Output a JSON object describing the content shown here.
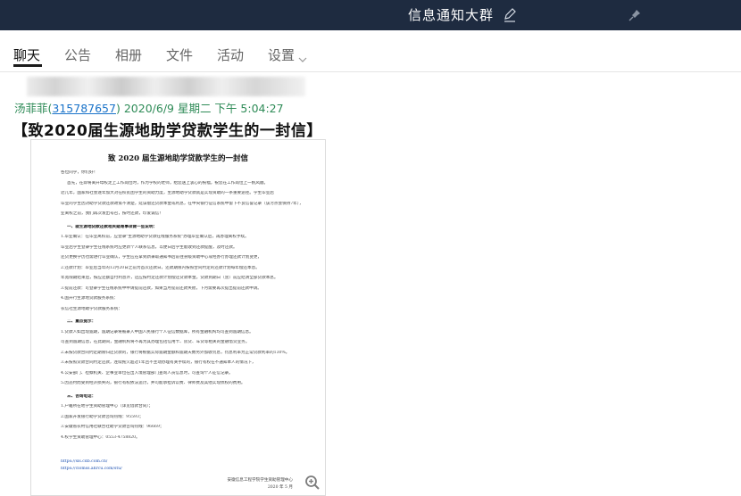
{
  "window": {
    "title": "信息通知大群"
  },
  "tabs": [
    {
      "label": "聊天",
      "active": true
    },
    {
      "label": "公告",
      "active": false
    },
    {
      "label": "相册",
      "active": false
    },
    {
      "label": "文件",
      "active": false
    },
    {
      "label": "活动",
      "active": false
    },
    {
      "label": "设置",
      "active": false
    }
  ],
  "message": {
    "sender_name": "汤菲菲(",
    "sender_qq": "315787657",
    "sender_close": ")",
    "timestamp": "2020/6/9 星期二 下午 5:04:27",
    "headline": "【致2020届生源地助学贷款学生的一封信】"
  },
  "document": {
    "title": "致 2020 届生源地助学贷款学生的一封信",
    "lines": [
      "各位同学，你们好！",
      "首先，在即将离开母校走上工作岗位时，作为学校的老师，给您送上衷心的祝福，祝您在工作岗位上一帆风顺。",
      "近几年，国家和社会逐年加大对在校贫困学生的资助力度，生源地助学贷款就是实现资助的一条重要途径。学生毕业后",
      "毕业的学生因对助学贷款还款政策不清楚，延误偿还贷款本金或利息，在中央银行征信系统中留下不良信誉记录（该污点会保持7年），",
      "业离校之前，我们再次发出号召，按时还款，珍爱诚信！",
      "一、就生源地贷款还款相关疑难事项做一些说明：",
      "1.毕业确认：在毕业离校前，应登录\"生源地助学贷款在线服务系统\"办理毕业确认后，再办理离校手续。",
      "毕业后学生登录学生在线系统时应更新个人联系信息，以便日后学生能收到还款提醒，及时还款。",
      "还贷更换学历也需进行毕业确认，学生应在拿到新录取通知书后前往县级资助中心或经办行办理还款计划变更，",
      "2.还款计划：毕业后当年的12月20日之前为首次还款日，还款期限内按照合同约定的还款计划每年偿还本息。",
      "年宽限期结束后，按应还额自付利息外，还应按约定还款计划偿还贷款本金。贷款到期日（含）前应结清全部贷款本息。",
      "3.提前还款：可登录学生在线系统中申请提前还款，如果当月提前还款失败，下月需要再次提出提前还款申请。",
      "4.国开行生源地贷款服务系统：",
      "农信社生源地助学贷款服务系统：",
      "二、重点提示：",
      "1.贷款人如出现逾期，逾期记录将被录入中国人民银行个人征信数据库，所有金融机构均可查到逾期信息。",
      "可查到逾期信息，在此期间，金融机构将不再为其办理包括信用卡、房贷、车贷等相关的金融借贷业务。",
      "2.未按贷款合同约定期限归还贷款的，银行将根据实际逾期金额和逾期天数另外加收罚息，罚息利率为正常贷款利率的130%。",
      "3.未按照贷款合同约定还款，连续拖欠超过1年且不主动办理有关手续的，银行有权在不通知本人的情况下，",
      "4.公安部门、检察机关、企事业单位在出入境管理部门查询人员信息时，可查询个人征信记录。",
      "5.因违约而受到经济损失的，银行有权依法追讨，并可能承担诉讼费、律师费及其他实现债权的费用。",
      "三、咨询电话：",
      "1.户籍所在地学生资助管理中心（详见借款合同）；",
      "2.国家开发银行助学贷款咨询热线：95593；",
      "3.安徽省农村信用社联合社助学贷款咨询热线：96669；",
      "4.校学生资助管理中心：0553-4758820。"
    ],
    "link1": "https://sls.cdb.com.cn/",
    "link2": "https://clomss.ahrcu.com/stu/",
    "signature": "安徽信息工程学院学生资助管理中心",
    "date": "2020 年 5 月"
  },
  "icons": {
    "edit": "pencil-icon",
    "pin": "pin-icon",
    "settings_chevron": "chevron-down-icon",
    "zoom": "zoom-in-icon"
  },
  "colors": {
    "titlebar": "#1e2b40",
    "sender": "#2e8b57",
    "link": "#1a73c9"
  }
}
